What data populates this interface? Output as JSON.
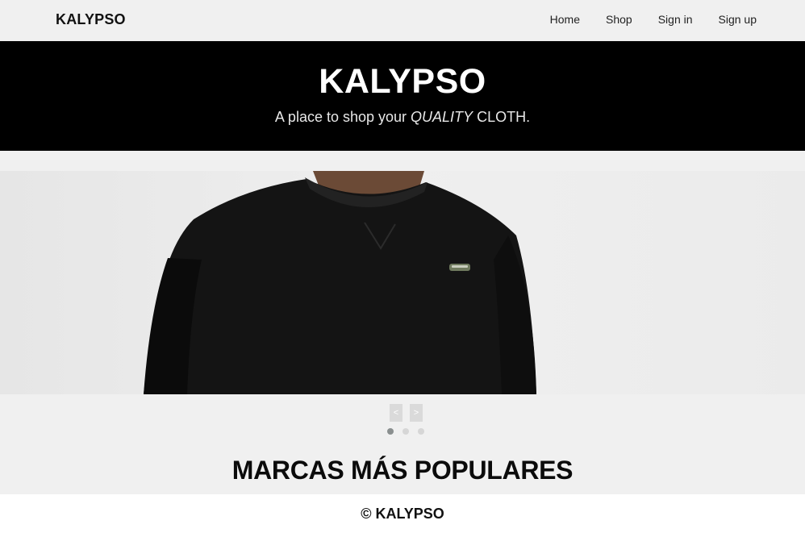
{
  "navbar": {
    "brand": "KALYPSO",
    "links": [
      {
        "label": "Home"
      },
      {
        "label": "Shop"
      },
      {
        "label": "Sign in"
      },
      {
        "label": "Sign up"
      }
    ]
  },
  "hero": {
    "title": "KALYPSO",
    "subtitle_prefix": "A place to shop your ",
    "subtitle_emphasis": "QUALITY",
    "subtitle_suffix": " CLOTH."
  },
  "carousel": {
    "slide_description_icon": "black-sweatshirt-photo",
    "prev_label": "<",
    "next_label": ">",
    "slide_count": 3,
    "active_slide": 1
  },
  "section": {
    "title": "MARCAS MÁS POPULARES"
  },
  "footer": {
    "text": "© KALYPSO"
  },
  "colors": {
    "background": "#f0f0f0",
    "hero_bg": "#000000",
    "footer_bg": "#ffffff",
    "dot_active": "#8a8f8f",
    "dot_inactive": "#d6d6d6"
  }
}
